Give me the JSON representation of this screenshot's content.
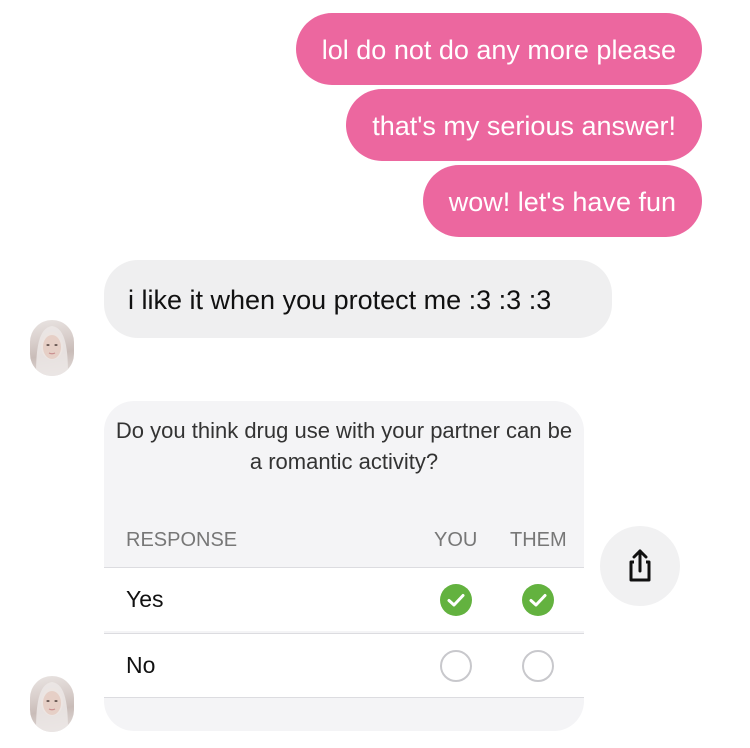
{
  "messages": {
    "outgoing": [
      {
        "text": "lol do not do any more please"
      },
      {
        "text": "that's my serious answer!"
      },
      {
        "text": "wow! let's have fun"
      }
    ],
    "incoming": [
      {
        "text": "i like it when you protect me :3 :3 :3"
      }
    ]
  },
  "poll": {
    "question": "Do you think drug use with your partner can be a romantic activity?",
    "headers": {
      "response": "RESPONSE",
      "you": "YOU",
      "them": "THEM"
    },
    "options": [
      {
        "label": "Yes",
        "you_selected": true,
        "them_selected": true
      },
      {
        "label": "No",
        "you_selected": false,
        "them_selected": false
      }
    ]
  },
  "icons": {
    "share": "share-icon",
    "check": "checkmark-icon",
    "avatar": "contact-avatar"
  },
  "colors": {
    "outgoing_bubble": "#ec679f",
    "incoming_bubble": "#efeff0",
    "check_green": "#63b23f"
  }
}
